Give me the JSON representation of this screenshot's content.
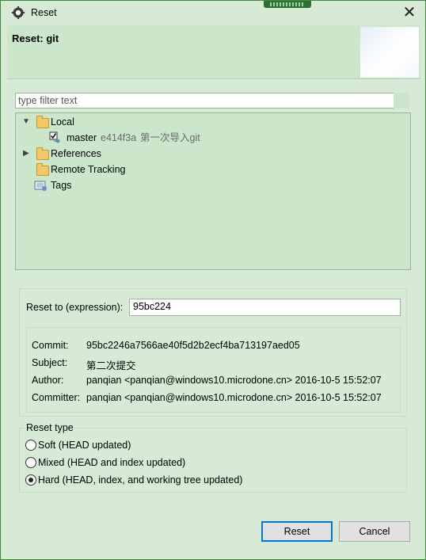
{
  "window": {
    "title": "Reset",
    "close_glyph": "✕"
  },
  "header": {
    "title": "Reset: git"
  },
  "filter": {
    "placeholder": "type filter text"
  },
  "tree": {
    "local_label": "Local",
    "master_name": "master",
    "master_hash": "e414f3a",
    "master_message": "第一次导入git",
    "references_label": "References",
    "remote_tracking_label": "Remote Tracking",
    "tags_label": "Tags"
  },
  "reset_to": {
    "label": "Reset to (expression):",
    "value": "95bc224"
  },
  "commit_info": {
    "commit_label": "Commit:",
    "commit_value": "95bc2246a7566ae40f5d2b2ecf4ba713197aed05",
    "subject_label": "Subject:",
    "subject_value": "第二次提交",
    "author_label": "Author:",
    "author_value": "panqian <panqian@windows10.microdone.cn> 2016-10-5 15:52:07",
    "committer_label": "Committer:",
    "committer_value": "panqian <panqian@windows10.microdone.cn> 2016-10-5 15:52:07"
  },
  "reset_type": {
    "legend": "Reset type",
    "options": [
      {
        "label": "Soft (HEAD updated)",
        "selected": false
      },
      {
        "label": "Mixed (HEAD and index updated)",
        "selected": false
      },
      {
        "label": "Hard (HEAD, index, and working tree updated)",
        "selected": true
      }
    ]
  },
  "buttons": {
    "reset": "Reset",
    "cancel": "Cancel"
  },
  "colors": {
    "dialog_bg": "#d6ead6",
    "tree_bg": "#cce6cc",
    "accent": "#0078d7"
  }
}
